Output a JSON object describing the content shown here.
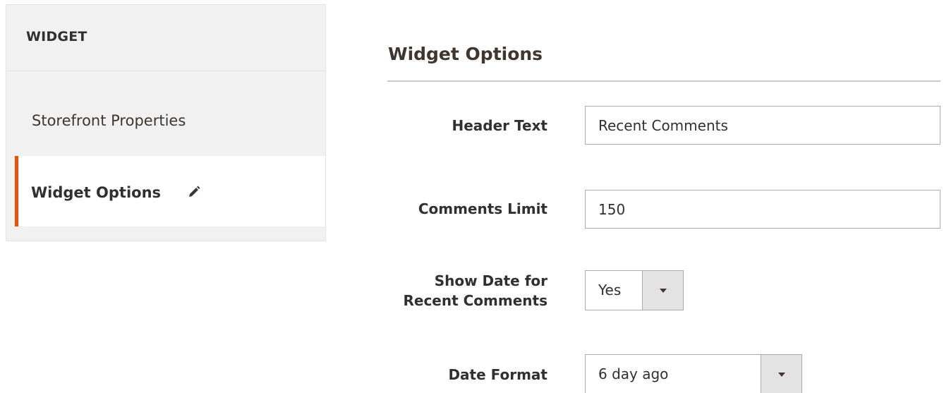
{
  "sidebar": {
    "title": "WIDGET",
    "items": [
      {
        "label": "Storefront Properties",
        "active": false
      },
      {
        "label": "Widget Options",
        "active": true,
        "icon": "pencil-icon"
      }
    ]
  },
  "main": {
    "section_title": "Widget Options",
    "fields": {
      "header_text": {
        "label": "Header Text",
        "value": "Recent Comments"
      },
      "comments_limit": {
        "label": "Comments Limit",
        "value": "150"
      },
      "show_date": {
        "label_line1": "Show Date for",
        "label_line2": "Recent Comments",
        "selected": "Yes"
      },
      "date_format": {
        "label": "Date Format",
        "selected": "6 day ago"
      }
    }
  },
  "colors": {
    "accent": "#eb5202",
    "sidebar_bg": "#f1f1f1",
    "text": "#303030",
    "input_border": "#adadad",
    "select_arrow_bg": "#e3e3e3"
  }
}
